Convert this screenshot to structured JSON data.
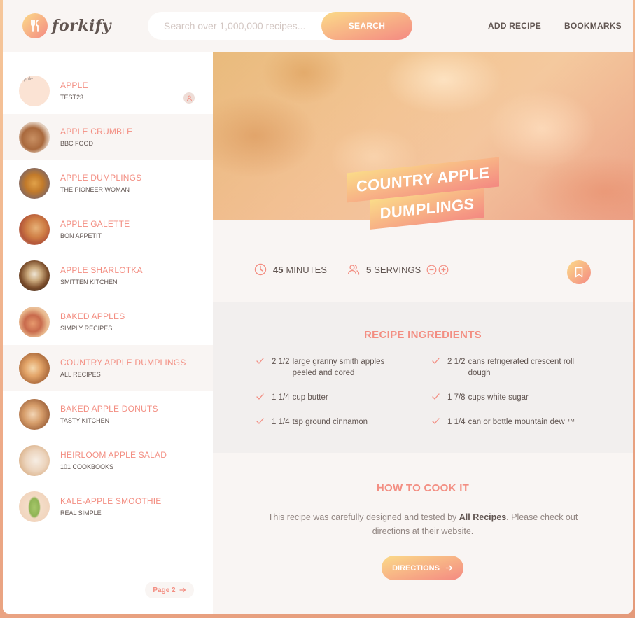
{
  "header": {
    "logo_text": "forkify",
    "search_placeholder": "Search over 1,000,000 recipes...",
    "search_button": "SEARCH",
    "nav": [
      "ADD RECIPE",
      "BOOKMARKS"
    ]
  },
  "results": [
    {
      "title": "APPLE",
      "publisher": "TEST23",
      "img_alt": "Apple",
      "user_generated": true,
      "active": false
    },
    {
      "title": "APPLE CRUMBLE",
      "publisher": "BBC FOOD",
      "active": true
    },
    {
      "title": "APPLE DUMPLINGS",
      "publisher": "THE PIONEER WOMAN",
      "active": false
    },
    {
      "title": "APPLE GALETTE",
      "publisher": "BON APPETIT",
      "active": false
    },
    {
      "title": "APPLE SHARLOTKA",
      "publisher": "SMITTEN KITCHEN",
      "active": false
    },
    {
      "title": "BAKED APPLES",
      "publisher": "SIMPLY RECIPES",
      "active": false
    },
    {
      "title": "COUNTRY APPLE DUMPLINGS",
      "publisher": "ALL RECIPES",
      "active": true
    },
    {
      "title": "BAKED APPLE DONUTS",
      "publisher": "TASTY KITCHEN",
      "active": false
    },
    {
      "title": "HEIRLOOM APPLE SALAD",
      "publisher": "101 COOKBOOKS",
      "active": false
    },
    {
      "title": "KALE-APPLE SMOOTHIE",
      "publisher": "REAL SIMPLE",
      "active": false
    }
  ],
  "pagination": {
    "next_label": "Page 2"
  },
  "recipe": {
    "title_line1": "COUNTRY APPLE",
    "title_line2": "DUMPLINGS",
    "minutes": "45",
    "minutes_label": "MINUTES",
    "servings": "5",
    "servings_label": "SERVINGS",
    "ingredients_heading": "RECIPE INGREDIENTS",
    "ingredients": [
      {
        "qty": "2 1/2",
        "desc": "large granny smith apples peeled and cored"
      },
      {
        "qty": "2 1/2",
        "desc": "cans refrigerated crescent roll dough"
      },
      {
        "qty": "1 1/4",
        "desc": "cup butter"
      },
      {
        "qty": "1 7/8",
        "desc": "cups white sugar"
      },
      {
        "qty": "1 1/4",
        "desc": "tsp ground cinnamon"
      },
      {
        "qty": "1 1/4",
        "desc": "can or bottle mountain dew ™"
      }
    ],
    "cook_heading": "HOW TO COOK IT",
    "cook_text_before": "This recipe was carefully designed and tested by ",
    "cook_publisher": "All Recipes",
    "cook_text_after": ". Please check out directions at their website.",
    "directions_button": "DIRECTIONS"
  },
  "colors": {
    "accent": "#f38e82",
    "gradient_start": "#fbdb89",
    "gradient_end": "#f48982",
    "text": "#615551"
  }
}
